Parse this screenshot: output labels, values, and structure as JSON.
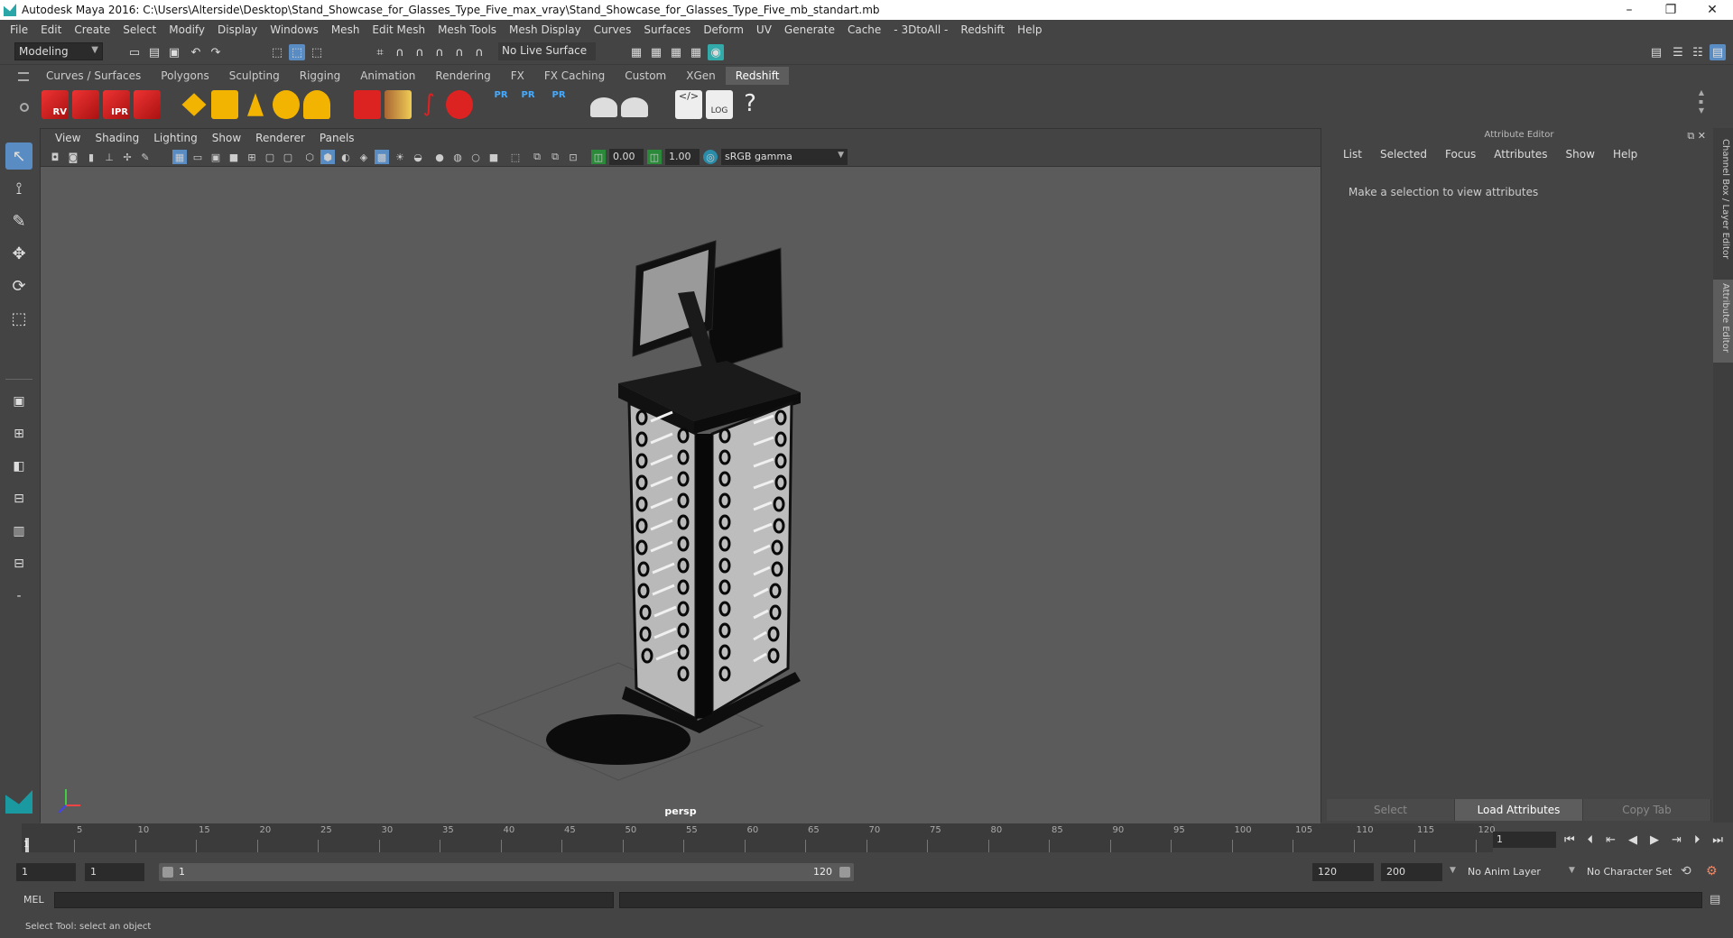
{
  "window": {
    "title": "Autodesk Maya 2016: C:\\Users\\Alterside\\Desktop\\Stand_Showcase_for_Glasses_Type_Five_max_vray\\Stand_Showcase_for_Glasses_Type_Five_mb_standart.mb",
    "minimize": "–",
    "restore": "❐",
    "close": "✕"
  },
  "menubar": [
    "File",
    "Edit",
    "Create",
    "Select",
    "Modify",
    "Display",
    "Windows",
    "Mesh",
    "Edit Mesh",
    "Mesh Tools",
    "Mesh Display",
    "Curves",
    "Surfaces",
    "Deform",
    "UV",
    "Generate",
    "Cache",
    "- 3DtoAll -",
    "Redshift",
    "Help"
  ],
  "statusline": {
    "mode": "Modeling",
    "live_surface": "No Live Surface"
  },
  "shelf": {
    "tabs": [
      "Curves / Surfaces",
      "Polygons",
      "Sculpting",
      "Rigging",
      "Animation",
      "Rendering",
      "FX",
      "FX Caching",
      "Custom",
      "XGen",
      "Redshift"
    ],
    "active_tab": "Redshift",
    "labels": {
      "rv": "RV",
      "ipr": "IPR",
      "pr": "PR",
      "log": "LOG",
      "help": "?"
    }
  },
  "viewport": {
    "menu": [
      "View",
      "Shading",
      "Lighting",
      "Show",
      "Renderer",
      "Panels"
    ],
    "exposure": "0.00",
    "gamma": "1.00",
    "color_space": "sRGB gamma",
    "camera": "persp"
  },
  "attribute_editor": {
    "title": "Attribute Editor",
    "menu": [
      "List",
      "Selected",
      "Focus",
      "Attributes",
      "Show",
      "Help"
    ],
    "message": "Make a selection to view attributes",
    "buttons": [
      "Select",
      "Load Attributes",
      "Copy Tab"
    ]
  },
  "side_tabs": [
    "Channel Box / Layer Editor",
    "Attribute Editor"
  ],
  "timeline": {
    "ticks": [
      5,
      10,
      15,
      20,
      25,
      30,
      35,
      40,
      45,
      50,
      55,
      60,
      65,
      70,
      75,
      80,
      85,
      90,
      95,
      100,
      105,
      110,
      115,
      120
    ],
    "current_frame_marker": "1",
    "current_frame": "1"
  },
  "range": {
    "start": "1",
    "playback_start": "1",
    "range_start": "1",
    "range_end": "120",
    "playback_end": "120",
    "end": "200",
    "anim_layer": "No Anim Layer",
    "character_set": "No Character Set"
  },
  "cmdline": {
    "label": "MEL"
  },
  "helpline": {
    "text": "Select Tool: select an object"
  }
}
